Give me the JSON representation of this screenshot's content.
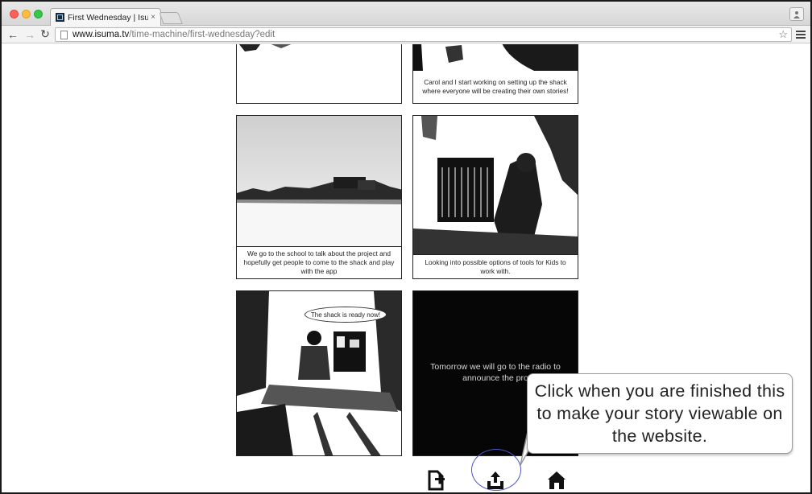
{
  "browser": {
    "tab_title": "First Wednesday | IsumaTV",
    "tab_close": "×",
    "url_host": "www.isuma.tv",
    "url_path": "/time-machine/first-wednesday?edit",
    "icons": [
      "back-arrow-icon",
      "forward-arrow-icon",
      "reload-icon",
      "page-icon",
      "bookmark-star-icon",
      "menu-icon",
      "profile-icon"
    ]
  },
  "story": {
    "panels": [
      {
        "caption": ""
      },
      {
        "caption": "Carol and I start working on setting up the shack where everyone will be creating their own stories!"
      },
      {
        "caption": "We go to the school to talk about the project and hopefully get people to come to the shack and play with the app"
      },
      {
        "caption": "Looking into possible options of tools for Kids to work with."
      },
      {
        "speech": "The shack is ready now!"
      },
      {
        "text": "Tomorrow we will go to the radio to announce the pro"
      }
    ]
  },
  "tooltip": {
    "text": "Click when you are finished this to make your story viewable on the website."
  },
  "actions": [
    "add-page-icon",
    "publish-upload-icon",
    "home-icon"
  ]
}
